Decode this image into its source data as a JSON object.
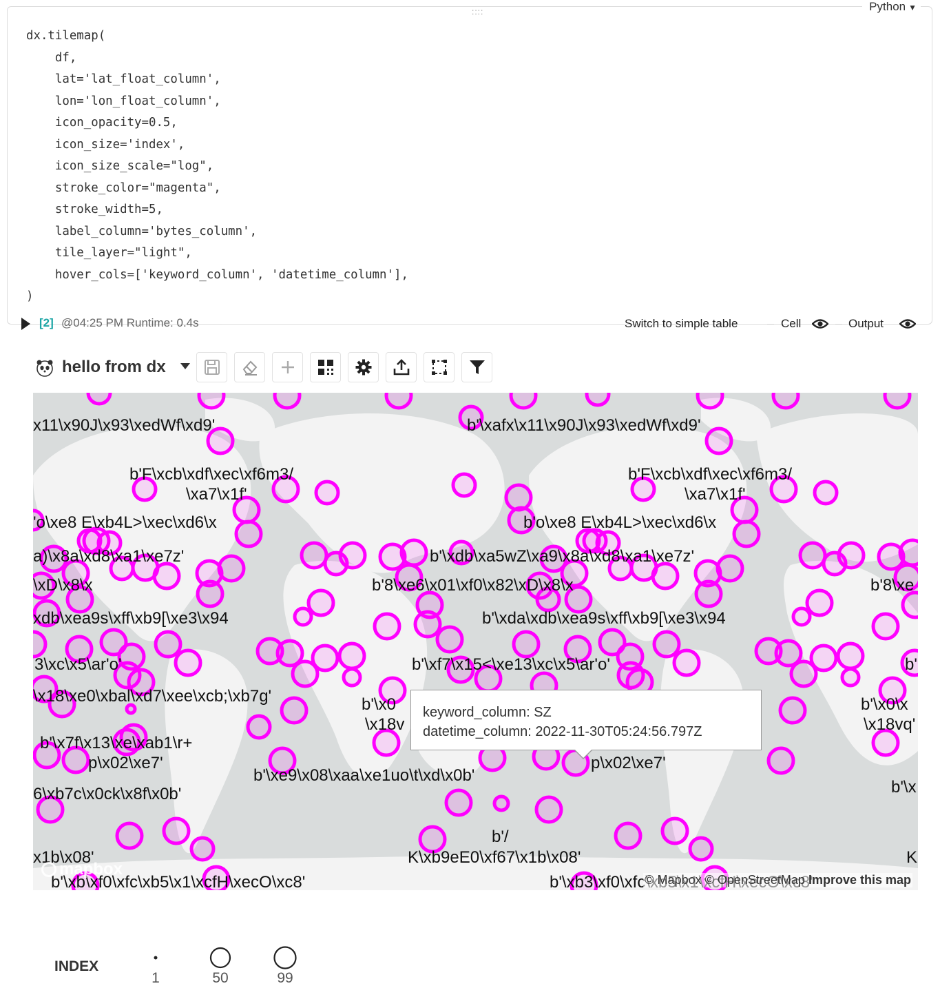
{
  "cell": {
    "language": "Python",
    "drag_handle": "::::",
    "code": [
      "dx.tilemap(",
      "    df,",
      "    lat='lat_float_column',",
      "    lon='lon_float_column',",
      "    icon_opacity=0.5,",
      "    icon_size='index',",
      "    icon_size_scale=\"log\",",
      "    stroke_color=\"magenta\",",
      "    stroke_width=5,",
      "    label_column='bytes_column',",
      "    tile_layer=\"light\",",
      "    hover_cols=['keyword_column', 'datetime_column'],",
      ")"
    ],
    "execution_count": "[2]",
    "execution_meta": "@04:25 PM Runtime: 0.4s",
    "switch_label": "Switch to simple table",
    "cell_toggle_label": "Cell",
    "output_toggle_label": "Output"
  },
  "dx": {
    "title": "hello from dx",
    "toolbar_icons": [
      "save-icon",
      "eraser-icon",
      "plus-icon",
      "qr-grid-icon",
      "gear-icon",
      "upload-icon",
      "crop-icon",
      "filter-icon"
    ]
  },
  "map": {
    "stroke_color": "#ff00ff",
    "tooltip": {
      "line1": "keyword_column: SZ",
      "line2": "datetime_column: 2022-11-30T05:24:56.797Z"
    },
    "labels": [
      "x11\\x90J\\x93\\xedWf\\xd9'",
      "b'\\xafx\\x11\\x90J\\x93\\xedWf\\xd9'",
      "b'F\\xcb\\xdf\\xec\\xf6m3/",
      "\\xa7\\x1f'",
      "b'F\\xcb\\xdf\\xec\\xf6m3/",
      "\\xa7\\x1f'",
      "'o\\xe8 E\\xb4L>\\xec\\xd6\\x",
      "b'o\\xe8 E\\xb4L>\\xec\\xd6\\x",
      "a)\\x8a\\xd8\\xa1\\xe7z'",
      "b'\\xdb\\xa5wZ\\xa9\\x8a\\xd8\\xa1\\xe7z'",
      "\\xD\\x8\\x",
      "b'8\\xe6\\x01\\xf0\\x82\\xD\\x8\\x",
      "b'8\\xe",
      "xdb\\xea9s\\xff\\xb9[\\xe3\\x94",
      "b'\\xda\\xdb\\xea9s\\xff\\xb9[\\xe3\\x94",
      "3\\xc\\x5\\ar'o'",
      "b'\\xf7\\x15<\\xe13\\xc\\x5\\ar'o'",
      "b'",
      "\\x18\\xe0\\xbal\\xd7\\xee\\xcb;\\xb7g'",
      "b'\\x0",
      "\\x18v",
      "b'\\x0\\x",
      "\\x18vq'",
      "b'\\x7f\\x13\\xe\\xab1\\r+",
      "p\\x02\\xe7'",
      "p\\x02\\xe7'",
      "b'\\xe9\\x08\\xaa\\xe1uo\\t\\xd\\x0b'",
      "6\\xb7c\\x0ck\\x8f\\x0b'",
      "b'\\x",
      "b'/",
      "K\\xb9eE0\\xf67\\x1b\\x08'",
      "x1b\\x08'",
      "K",
      "b'\\xb\\xf0\\xfc\\xb5\\x1\\xcfH\\xecO\\xc8'",
      "b'\\xb3\\xf0\\xfc\\xb5\\x1\\xcfH\\xecO\\xc8'"
    ],
    "logo_text": "mapbox",
    "attribution": "© Mapbox © OpenStreetMap",
    "improve_link": "Improve this map"
  },
  "legend": {
    "title": "INDEX",
    "items": [
      {
        "label": "1",
        "value": 1
      },
      {
        "label": "50",
        "value": 50
      },
      {
        "label": "99",
        "value": 99
      }
    ]
  }
}
